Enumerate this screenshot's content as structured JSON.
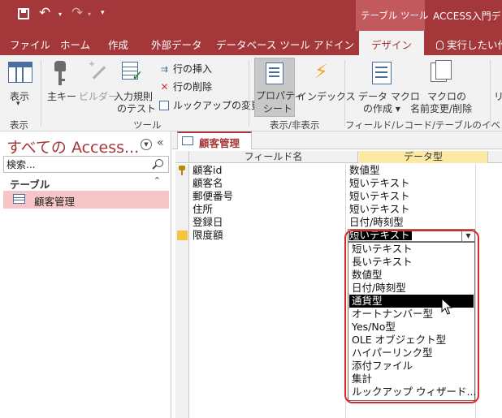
{
  "titlebar": {
    "context_group": "テーブル ツール",
    "window_title": "ACCESS入門デ"
  },
  "ribbon_tabs": {
    "file": "ファイル",
    "home": "ホーム",
    "create": "作成",
    "external": "外部データ",
    "dbtools": "データベース ツール",
    "addin": "アドイン",
    "design": "デザイン",
    "tellme": "実行したい作"
  },
  "ribbon": {
    "view": "表示",
    "view_dd": "▾",
    "primary_key": "主キー",
    "builder": "ビルダー",
    "test_rules_1": "入力規則",
    "test_rules_2": "のテスト",
    "insert_rows": "行の挿入",
    "delete_rows": "行の削除",
    "modify_lookups": "ルックアップの変更",
    "property_sheet_1": "プロパティ",
    "property_sheet_2": "シート",
    "indexes": "インデックス",
    "create_macro_1": "データ マクロ",
    "create_macro_2": "の作成 ▾",
    "rename_macro_1": "マクロの",
    "rename_macro_2": "名前変更/削除",
    "overflow": "リ",
    "groups": {
      "views": "表示",
      "tools": "ツール",
      "show_hide": "表示/非表示",
      "events": "フィールド/レコード/テーブルのイベント"
    }
  },
  "nav": {
    "title": "すべての Access...",
    "search_placeholder": "検索...",
    "group_label": "テーブル",
    "items": [
      {
        "label": "顧客管理"
      }
    ]
  },
  "document": {
    "tab_label": "顧客管理",
    "headers": {
      "field_name": "フィールド名",
      "data_type": "データ型"
    },
    "rows": [
      {
        "field": "顧客id",
        "type": "数値型",
        "primary_key": true
      },
      {
        "field": "顧客名",
        "type": "短いテキスト"
      },
      {
        "field": "郵便番号",
        "type": "短いテキスト"
      },
      {
        "field": "住所",
        "type": "短いテキスト"
      },
      {
        "field": "登録日",
        "type": "日付/時刻型"
      },
      {
        "field": "限度額",
        "type": "短いテキスト",
        "current": true
      }
    ]
  },
  "dropdown": {
    "options": [
      "短いテキスト",
      "長いテキスト",
      "数値型",
      "日付/時刻型",
      "通貨型",
      "オートナンバー型",
      "Yes/No型",
      "OLE オブジェクト型",
      "ハイパーリンク型",
      "添付ファイル",
      "集計",
      "ルックアップ ウィザード..."
    ],
    "highlighted": "通貨型"
  },
  "colors": {
    "accent": "#a4373a",
    "selected_nav_item": "#f5c5c7",
    "annotation_outline": "#e02626"
  }
}
